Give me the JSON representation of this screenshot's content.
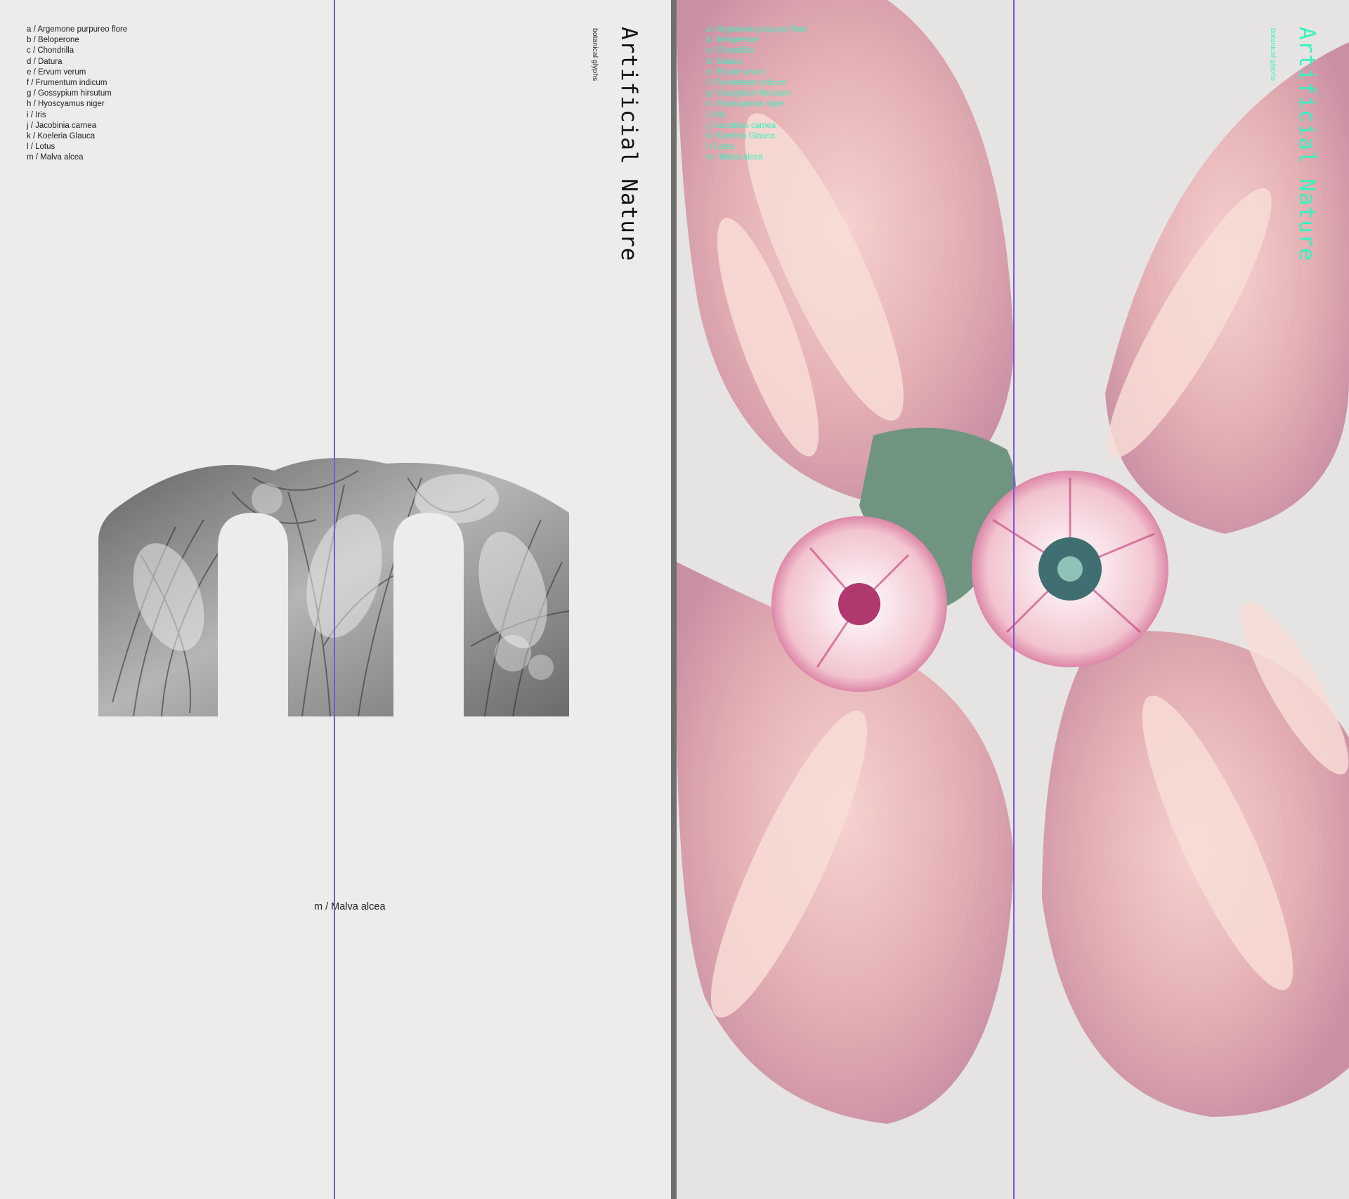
{
  "species_list": [
    "a / Argemone purpureo flore",
    "b / Beloperone",
    "c / Chondrilla",
    "d / Datura",
    "e / Ervum verum",
    "f / Frumentum indicum",
    "g / Gossypium hirsutum",
    "h / Hyoscyamus niger",
    "i / Iris",
    "j / Jacobinia carnea",
    "k / Koeleria Glauca",
    "l / Lotus",
    "m / Malva alcea"
  ],
  "title": "Artificial Nature",
  "subtitle": "botanical glyphs",
  "caption": "m / Malva alcea",
  "colors": {
    "accent_text": "#35f2c0",
    "guide_line": "#7a55e0",
    "left_background": "#ececea",
    "petal_pink": "#e8b8b8",
    "flower_magenta": "#c23a78",
    "leaf_green": "#6f9580"
  }
}
